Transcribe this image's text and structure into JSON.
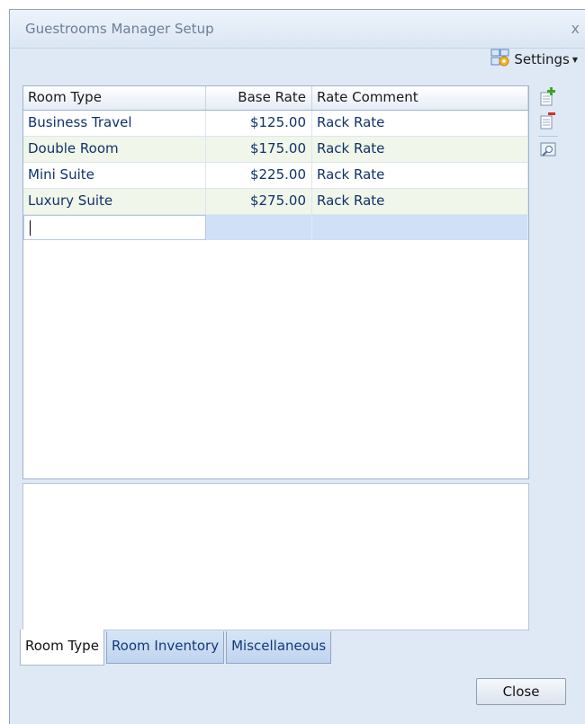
{
  "window": {
    "title": "Guestrooms Manager Setup",
    "close_glyph": "x"
  },
  "toolbar": {
    "settings_label": "Settings",
    "settings_icon": "settings-icon"
  },
  "grid": {
    "columns": [
      "Room Type",
      "Base Rate",
      "Rate Comment"
    ],
    "rows": [
      {
        "room_type": "Business Travel",
        "base_rate": "$125.00",
        "rate_comment": "Rack Rate"
      },
      {
        "room_type": "Double Room",
        "base_rate": "$175.00",
        "rate_comment": "Rack Rate"
      },
      {
        "room_type": "Mini Suite",
        "base_rate": "$225.00",
        "rate_comment": "Rack Rate"
      },
      {
        "room_type": "Luxury Suite",
        "base_rate": "$275.00",
        "rate_comment": "Rack Rate"
      }
    ]
  },
  "side_toolbar": {
    "icons": [
      "add-row-icon",
      "delete-row-icon",
      "preview-icon"
    ]
  },
  "tabs": [
    "Room Type",
    "Room Inventory",
    "Miscellaneous"
  ],
  "footer": {
    "close_label": "Close"
  }
}
